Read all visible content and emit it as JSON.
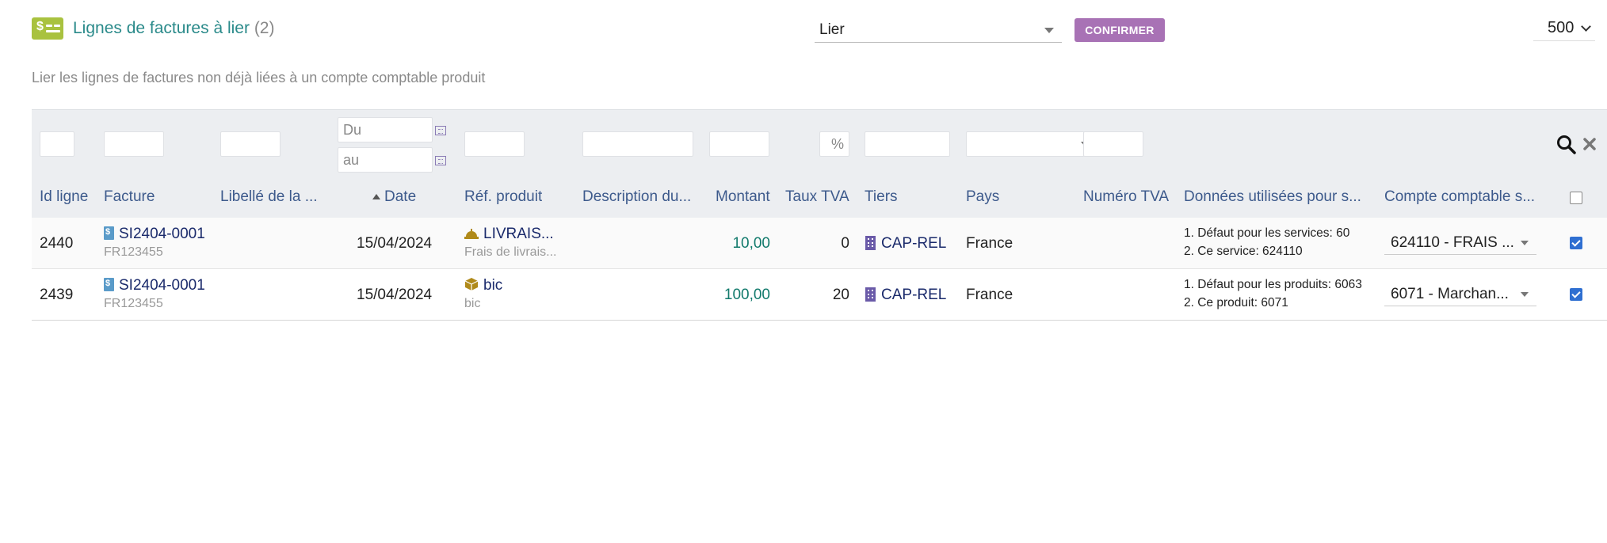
{
  "header": {
    "title": "Lignes de factures à lier",
    "count": "(2)",
    "subtitle": "Lier les lignes de factures non déjà liées à un compte comptable produit",
    "mass_action": "Lier",
    "confirm_label": "CONFIRMER",
    "limit": "500"
  },
  "filters": {
    "date_from_placeholder": "Du",
    "date_to_placeholder": "au",
    "vat_rate_placeholder": "%"
  },
  "columns": {
    "id": "Id ligne",
    "invoice": "Facture",
    "label": "Libellé de la ...",
    "date": "Date",
    "product_ref": "Réf. produit",
    "description": "Description du...",
    "amount": "Montant",
    "vat_rate": "Taux TVA",
    "thirdparty": "Tiers",
    "country": "Pays",
    "vat_number": "Numéro TVA",
    "data_used": "Données utilisées pour s...",
    "account": "Compte comptable s..."
  },
  "rows": [
    {
      "id": "2440",
      "invoice": "SI2404-0001",
      "invoice_sub": "FR123455",
      "date": "15/04/2024",
      "product": "LIVRAIS...",
      "product_sub": "Frais de livrais...",
      "amount": "10,00",
      "vat_rate": "0",
      "thirdparty": "CAP-REL",
      "country": "France",
      "data_line1": "1. Défaut pour les services: 60",
      "data_line2": "2. Ce service: 624110",
      "account": "624110 - FRAIS ...",
      "product_icon": "service-bell-icon"
    },
    {
      "id": "2439",
      "invoice": "SI2404-0001",
      "invoice_sub": "FR123455",
      "date": "15/04/2024",
      "product": "bic",
      "product_sub": "bic",
      "amount": "100,00",
      "vat_rate": "20",
      "thirdparty": "CAP-REL",
      "country": "France",
      "data_line1": "1. Défaut pour les produits: 6063",
      "data_line2": "2. Ce produit: 6071",
      "account": "6071 - Marchan...",
      "product_icon": "product-box-icon"
    }
  ],
  "colors": {
    "accent": "#a872b5",
    "title": "#2a8a8a",
    "header_text": "#3d5a8c",
    "amount": "#127a6c",
    "filter_bg": "#eceef1"
  }
}
